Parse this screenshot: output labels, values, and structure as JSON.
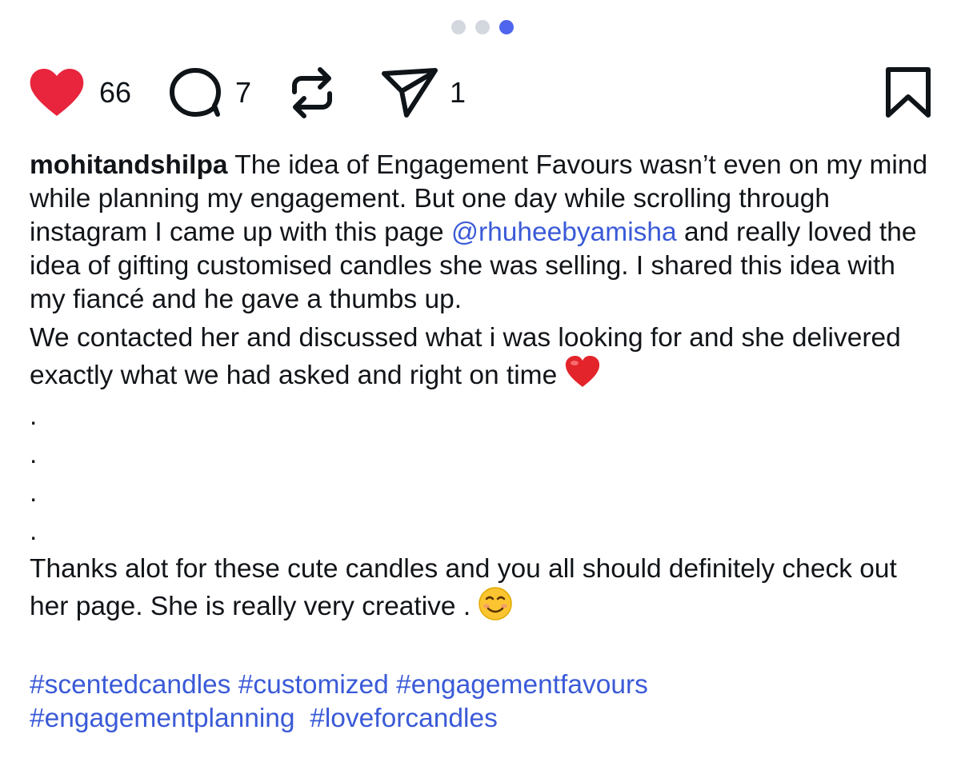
{
  "carousel": {
    "dots": [
      {
        "active": false
      },
      {
        "active": false
      },
      {
        "active": true
      }
    ]
  },
  "actions": {
    "like_count": "66",
    "comment_count": "7",
    "share_count": "1"
  },
  "icons": {
    "like": "heart-icon",
    "comment": "comment-bubble-icon",
    "repost": "repost-icon",
    "share": "send-icon",
    "bookmark": "bookmark-icon"
  },
  "colors": {
    "like_red": "#e8253d",
    "link_blue": "#3a5ad7",
    "active_dot": "#4f65ee",
    "inactive_dot": "#d3d7de",
    "text": "#111418"
  },
  "caption": {
    "username": "mohitandshilpa",
    "text_1a": " The idea of Engagement Favours wasn’t even on my mind while planning my engagement. But one day while scrolling through instagram I came up with this page ",
    "mention": "@rhuheebyamisha",
    "text_1b": " and really loved the idea of gifting customised candles she was selling. I shared this idea with my fiancé and he gave a thumbs up.",
    "text_2": "We contacted her and discussed what i was looking for and she delivered exactly what we had asked and right on time ",
    "heart_emoji": "❤️",
    "dot_lines": [
      ".",
      ".",
      ".",
      "."
    ],
    "text_3": "Thanks alot for these cute candles and you all should definitely check out her page. She is really very creative . ",
    "smile_emoji": "😊",
    "hashtags": [
      "#scentedcandles",
      "#customized",
      "#engagementfavours",
      "#engagementplanning",
      "#loveforcandles"
    ]
  }
}
